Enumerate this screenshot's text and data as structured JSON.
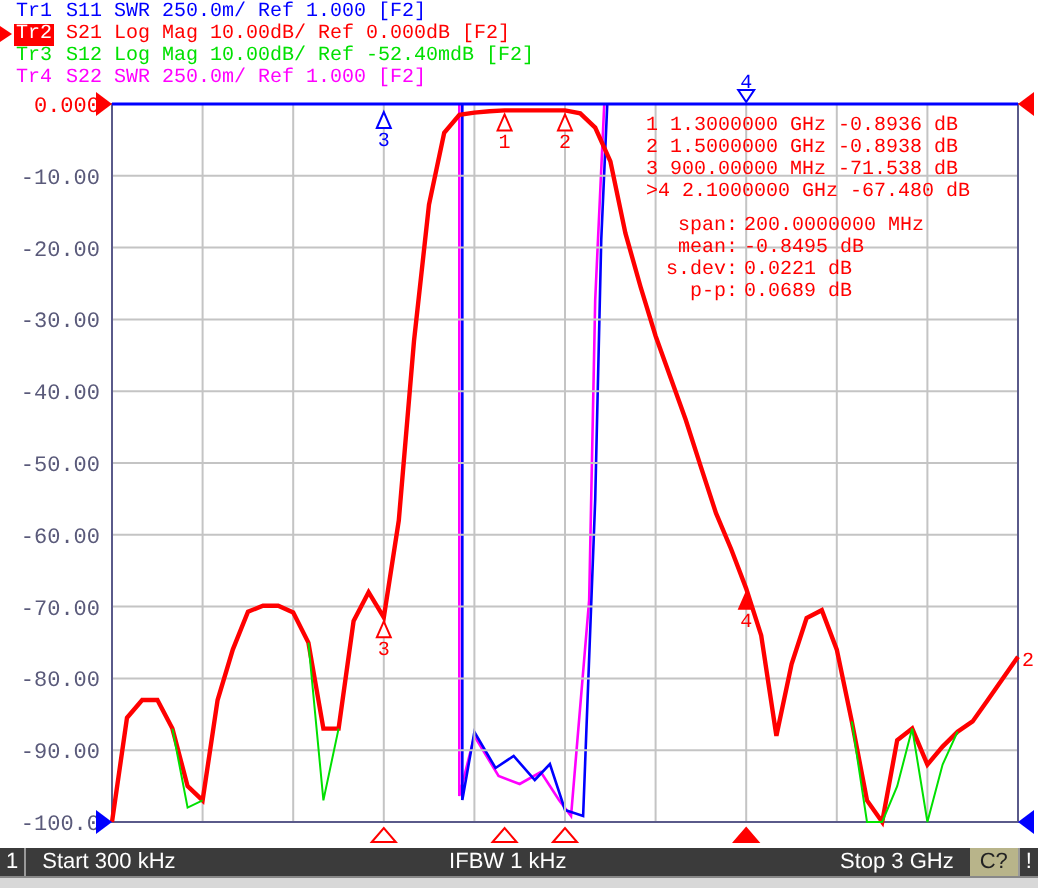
{
  "traces": [
    {
      "name": "Tr1",
      "info": "S11 SWR 250.0m/ Ref 1.000 [F2]",
      "color": "#0000ff",
      "selected": false
    },
    {
      "name": "Tr2",
      "info": "S21 Log Mag 10.00dB/ Ref 0.000dB [F2]",
      "color": "#ff0000",
      "selected": true
    },
    {
      "name": "Tr3",
      "info": "S12 Log Mag 10.00dB/ Ref -52.40mdB [F2]",
      "color": "#00e000",
      "selected": false
    },
    {
      "name": "Tr4",
      "info": "S22 SWR 250.0m/ Ref 1.000 [F2]",
      "color": "#ff00ff",
      "selected": false
    }
  ],
  "plot": {
    "chart_data": {
      "type": "line",
      "ylim": [
        -100,
        0
      ],
      "grid": true,
      "yticks": [
        {
          "value": 0,
          "label": "0.000"
        },
        {
          "value": -10,
          "label": "-10.00"
        },
        {
          "value": -20,
          "label": "-20.00"
        },
        {
          "value": -30,
          "label": "-30.00"
        },
        {
          "value": -40,
          "label": "-40.00"
        },
        {
          "value": -50,
          "label": "-50.00"
        },
        {
          "value": -60,
          "label": "-60.00"
        },
        {
          "value": -70,
          "label": "-70.00"
        },
        {
          "value": -80,
          "label": "-80.00"
        },
        {
          "value": -90,
          "label": "-90.00"
        },
        {
          "value": -100,
          "label": "-100.0"
        }
      ],
      "categories": [
        null,
        null,
        null,
        null,
        null,
        null,
        null,
        null,
        null,
        null,
        null,
        null,
        null,
        null,
        null,
        null,
        null,
        null,
        null,
        null,
        null,
        null,
        null,
        null,
        null,
        null,
        null,
        null,
        null,
        null,
        null,
        null,
        null,
        null,
        null,
        null,
        null,
        null,
        null,
        null,
        null,
        null,
        null,
        null,
        null,
        null,
        null,
        null,
        null,
        null,
        null,
        null,
        null,
        null,
        null,
        null,
        null,
        null,
        null,
        null,
        null
      ],
      "series": [
        {
          "color": "#ff0000",
          "values": [
            -100,
            -85.5,
            -83,
            -83,
            -87,
            -95,
            -97,
            -83,
            -76,
            -70.7,
            -69.9,
            -69.9,
            -70.8,
            -75,
            -87,
            -87,
            -72,
            -68,
            -71.5,
            -58,
            -33,
            -14,
            -4,
            -1.5,
            -1.2,
            -1,
            -0.9,
            -0.9,
            -0.9,
            -0.9,
            -0.9,
            -1.3,
            -3.3,
            -8,
            -18,
            -25.5,
            -32.3,
            -38.2,
            -44,
            -50.5,
            -57,
            -62,
            -67.5,
            -74,
            -88,
            -78,
            -71.6,
            -70.5,
            -76,
            -86,
            -97,
            -100,
            -88.6,
            -87,
            -92,
            -89.5,
            -87.4,
            -86,
            -83,
            -80,
            -77
          ]
        },
        {
          "color": "#00e000",
          "values": [
            null,
            null,
            null,
            null,
            -87,
            -98,
            -97,
            null,
            null,
            null,
            null,
            null,
            null,
            -75,
            -97,
            -87,
            null,
            null,
            null,
            null,
            null,
            null,
            null,
            null,
            null,
            null,
            null,
            null,
            null,
            null,
            null,
            null,
            null,
            null,
            null,
            null,
            null,
            null,
            null,
            null,
            null,
            null,
            null,
            null,
            null,
            null,
            null,
            null,
            null,
            -86,
            -100,
            -100,
            -95,
            -87,
            -100,
            -92,
            -87.4,
            null,
            null,
            null,
            null
          ]
        }
      ]
    },
    "markers": [
      {
        "text": "1",
        "color": "#ff0000",
        "active": false
      },
      {
        "text": "2",
        "color": "#ff0000",
        "active": false
      },
      {
        "text": "3",
        "color": "#ff0000",
        "active": false
      },
      {
        "text": "4",
        "color": "#ff0000",
        "active": true
      },
      {
        "text": "3",
        "color": "#0000ff",
        "active": false
      }
    ],
    "top_marker_label": "4",
    "trace_end_label": "2",
    "marker_table": [
      {
        "num": "1",
        "freq": "1.3000000 GHz",
        "value": "-0.8936 dB"
      },
      {
        "num": "2",
        "freq": "1.5000000 GHz",
        "value": "-0.8938 dB"
      },
      {
        "num": "3",
        "freq": "900.00000 MHz",
        "value": "-71.538 dB"
      },
      {
        "prefix": ">",
        "num": "4",
        "freq": "2.1000000 GHz",
        "value": "-67.480 dB"
      }
    ],
    "stats": [
      {
        "label": "span:",
        "value": "200.0000000 MHz"
      },
      {
        "label": "mean:",
        "value": "-0.8495 dB"
      },
      {
        "label": "s.dev:",
        "value": "0.0221 dB"
      },
      {
        "label": "p-p:",
        "value": "0.0689 dB"
      }
    ]
  },
  "status_bar": {
    "channel": "1",
    "start": "Start 300 kHz",
    "ifbw": "IFBW 1 kHz",
    "stop": "Stop 3 GHz",
    "calibration": "C?",
    "warning": "!"
  }
}
